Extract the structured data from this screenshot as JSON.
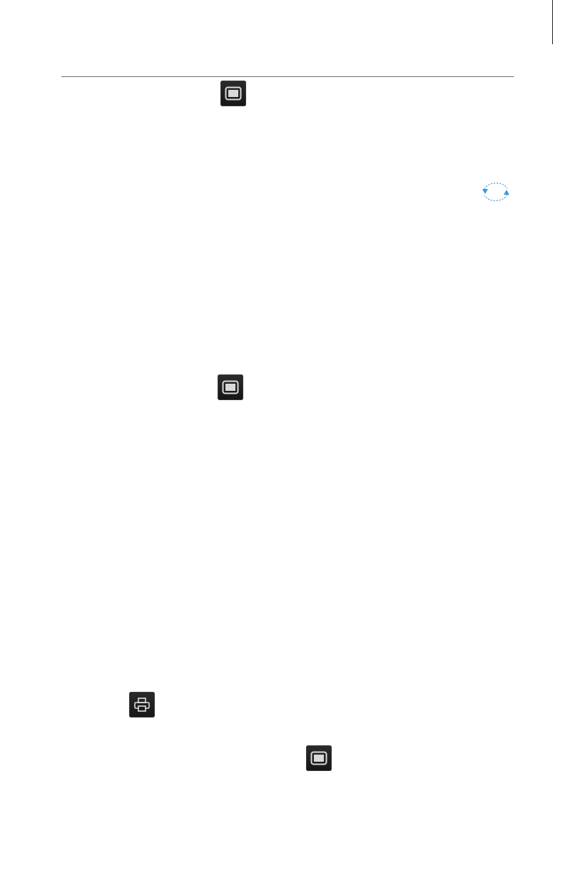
{
  "page": {
    "background": "#ffffff",
    "rule_color": "#6d6e71"
  },
  "icons": [
    {
      "name": "monitor-icon"
    },
    {
      "name": "sync-icon",
      "color": "#3b9ad9"
    },
    {
      "name": "monitor-icon"
    },
    {
      "name": "printer-icon"
    },
    {
      "name": "monitor-icon"
    }
  ]
}
